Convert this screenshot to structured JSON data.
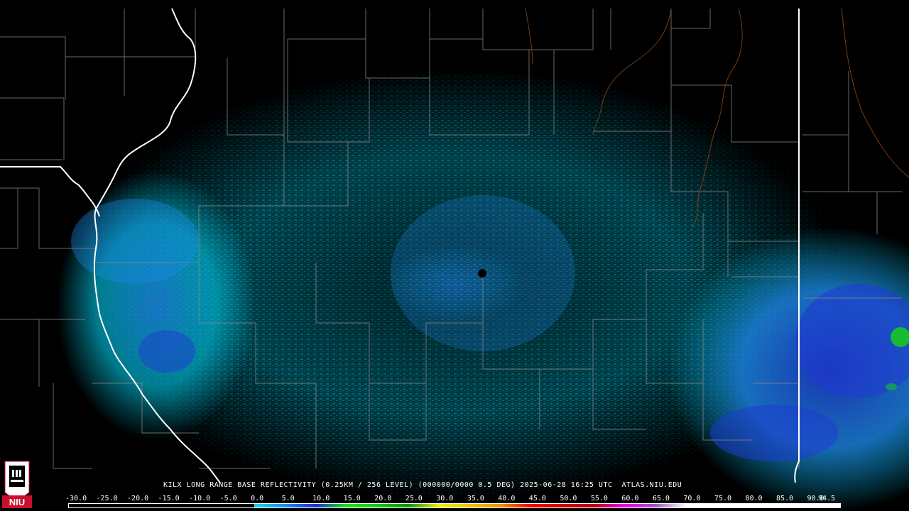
{
  "product_caption": "KILX LONG RANGE BASE REFLECTIVITY (0.25KM / 256 LEVEL) (000000/0000 0.5 DEG) 2025-06-28 16:25 UTC  ATLAS.NIU.EDU",
  "logo_text": "NIU",
  "scale": {
    "labels": [
      "-30.0",
      "-25.0",
      "-20.0",
      "-15.0",
      "-10.0",
      "-5.0",
      "0.0",
      "5.0",
      "10.0",
      "15.0",
      "20.0",
      "25.0",
      "30.0",
      "35.0",
      "40.0",
      "45.0",
      "50.0",
      "55.0",
      "60.0",
      "65.0",
      "70.0",
      "75.0",
      "80.0",
      "85.0",
      "90.0",
      "94.5"
    ],
    "colors": [
      "#000000",
      "#000000",
      "#000000",
      "#000000",
      "#000000",
      "#000000",
      "#16d9e6",
      "#1a8cf0",
      "#1a2ddc",
      "#18e418",
      "#14c814",
      "#0c9410",
      "#f0f000",
      "#f0c000",
      "#f09000",
      "#f00000",
      "#d00000",
      "#b40000",
      "#f000f0",
      "#9a55c8",
      "#ffffff",
      "#ffffff",
      "#ffffff",
      "#ffffff",
      "#ffffff"
    ]
  },
  "map": {
    "radar_site": "KILX",
    "echo_colors": {
      "light": "#00c8e6",
      "medium": "#1e8cf0",
      "heavy": "#1e3cd2",
      "strong": "#16c81e"
    }
  }
}
